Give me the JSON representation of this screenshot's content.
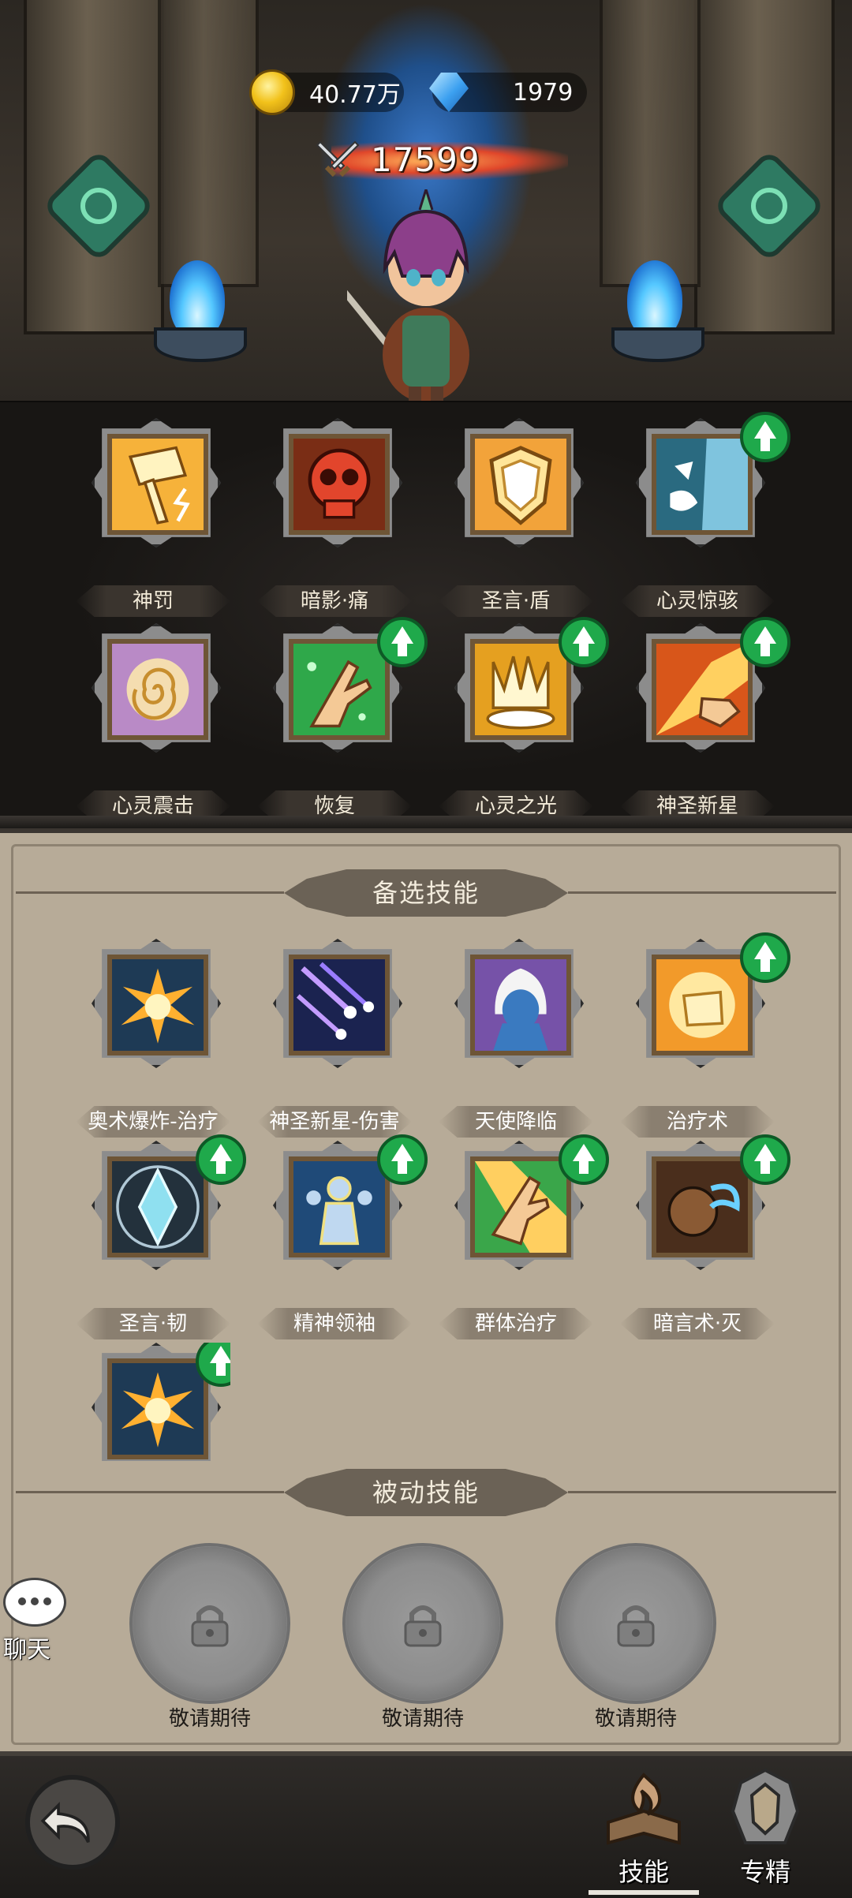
{
  "currency": {
    "gold": "40.77万",
    "gems": "1979",
    "gold_icon": "gold-coin-icon",
    "gem_icon": "blue-gem-icon"
  },
  "power": {
    "value": "17599",
    "icon": "crossed-swords-icon"
  },
  "equipped_skills": [
    {
      "name": "神罚",
      "icon": "hammer-lightning-icon",
      "upgrade": false
    },
    {
      "name": "暗影·痛",
      "icon": "skull-icon",
      "upgrade": false
    },
    {
      "name": "圣言·盾",
      "icon": "shield-icon",
      "upgrade": false
    },
    {
      "name": "心灵惊骇",
      "icon": "scream-face-icon",
      "upgrade": true
    },
    {
      "name": "心灵震击",
      "icon": "spiral-icon",
      "upgrade": false
    },
    {
      "name": "恢复",
      "icon": "healing-hand-icon",
      "upgrade": true
    },
    {
      "name": "心灵之光",
      "icon": "crown-light-icon",
      "upgrade": true
    },
    {
      "name": "神圣新星",
      "icon": "fire-hand-icon",
      "upgrade": true
    }
  ],
  "reserve": {
    "title": "备选技能",
    "skills": [
      {
        "name": "奥术爆炸-治疗",
        "icon": "explosion-icon",
        "upgrade": false
      },
      {
        "name": "神圣新星-伤害",
        "icon": "meteor-icon",
        "upgrade": false
      },
      {
        "name": "天使降临",
        "icon": "angel-icon",
        "upgrade": false
      },
      {
        "name": "治疗术",
        "icon": "glowing-fist-icon",
        "upgrade": true
      },
      {
        "name": "圣言·韧",
        "icon": "crystal-icon",
        "upgrade": true
      },
      {
        "name": "精神领袖",
        "icon": "spirit-leader-icon",
        "upgrade": true
      },
      {
        "name": "群体治疗",
        "icon": "group-heal-icon",
        "upgrade": true
      },
      {
        "name": "暗言术·灭",
        "icon": "shadow-word-icon",
        "upgrade": true
      },
      {
        "name": "",
        "icon": "explosion-icon",
        "upgrade": true
      }
    ]
  },
  "passive": {
    "title": "被动技能",
    "slots": [
      {
        "label": "敬请期待",
        "icon": "lock-icon"
      },
      {
        "label": "敬请期待",
        "icon": "lock-icon"
      },
      {
        "label": "敬请期待",
        "icon": "lock-icon"
      }
    ]
  },
  "chat": {
    "label": "聊天",
    "icon": "chat-bubble-icon"
  },
  "nav": {
    "back_icon": "back-arrow-icon",
    "tabs": [
      {
        "label": "技能",
        "icon": "skill-book-icon",
        "active": true
      },
      {
        "label": "专精",
        "icon": "specialization-icon",
        "active": false
      }
    ]
  },
  "colors": {
    "upgrade_badge": "#1fa94b",
    "panel_bg": "#b7ab98",
    "dark_panel": "#1b1917"
  }
}
